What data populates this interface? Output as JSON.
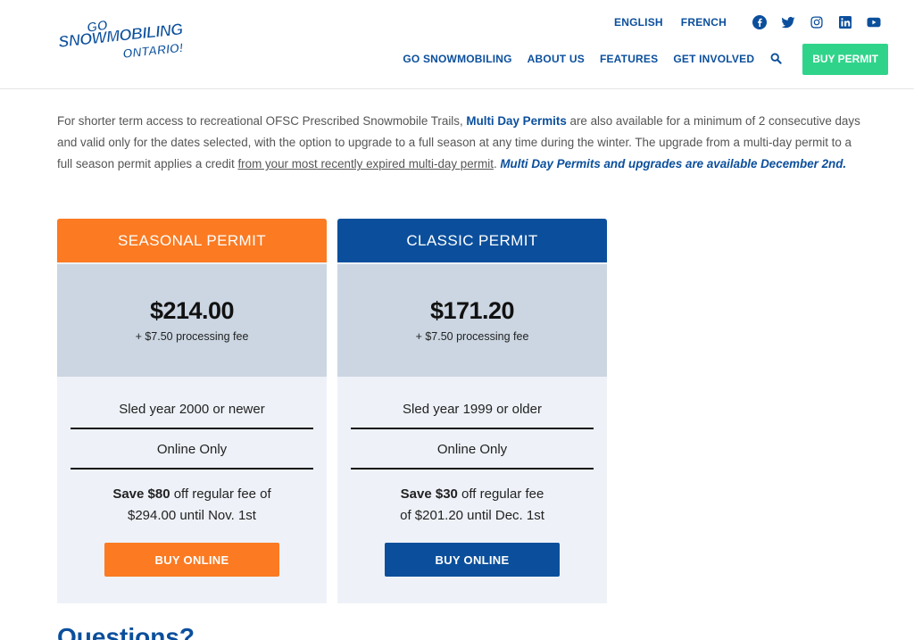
{
  "header": {
    "logo": {
      "line1": "GO",
      "line2": "SNOWMOBILING",
      "line3": "ONTARIO!"
    },
    "languages": [
      "ENGLISH",
      "FRENCH"
    ],
    "social_icons": [
      "facebook-icon",
      "twitter-icon",
      "instagram-icon",
      "linkedin-icon",
      "youtube-icon"
    ],
    "nav": [
      "GO SNOWMOBILING",
      "ABOUT US",
      "FEATURES",
      "GET INVOLVED"
    ],
    "buy_permit_label": "BUY PERMIT"
  },
  "intro": {
    "p1": "For shorter term access to recreational OFSC Prescribed Snowmobile Trails, ",
    "p2": "Multi Day Permits",
    "p3": " are also available for a minimum of 2 consecutive days and valid only for the dates selected, with the option to upgrade to a full season at any time during the winter. The upgrade from a multi-day permit to a full season permit applies a credit ",
    "p4": "from your most recently expired multi-day permit",
    "p5": ". ",
    "p6": "Multi Day Permits and upgrades are available December 2nd."
  },
  "cards": [
    {
      "title": "SEASONAL PERMIT",
      "price": "$214.00",
      "fee": "+ $7.50 processing fee",
      "feature1": "Sled year 2000 or newer",
      "feature2": "Online Only",
      "save_bold": "Save $80",
      "save_rest": " off regular fee of",
      "save_line2": "$294.00 until Nov. 1st",
      "button": "BUY ONLINE"
    },
    {
      "title": "CLASSIC PERMIT",
      "price": "$171.20",
      "fee": "+ $7.50 processing fee",
      "feature1": "Sled year 1999 or older",
      "feature2": "Online Only",
      "save_bold": "Save $30",
      "save_rest": " off regular fee",
      "save_line2": "of $201.20 until Dec. 1st",
      "button": "BUY ONLINE"
    }
  ],
  "questions_heading": "Questions?",
  "colors": {
    "brand_blue": "#0b4f9c",
    "orange": "#fb7a22",
    "green": "#2fd48a"
  }
}
